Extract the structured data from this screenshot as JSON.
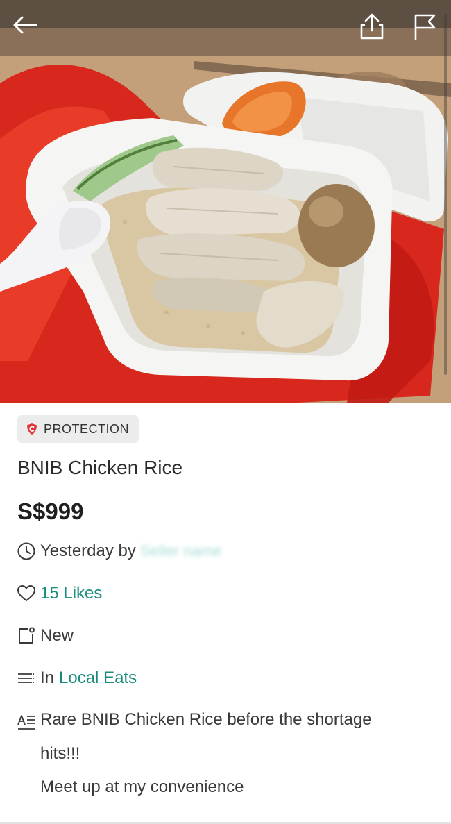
{
  "listing": {
    "badge": "PROTECTION",
    "title": "BNIB Chicken Rice",
    "price": "S$999",
    "time_prefix": "Yesterday by",
    "seller": "Seller name",
    "likes": "15 Likes",
    "condition": "New",
    "category_prefix": "In",
    "category": "Local Eats",
    "description": [
      "Rare BNIB Chicken Rice before the shortage",
      "hits!!!",
      "Meet up at my convenience"
    ]
  },
  "icons": {
    "back": "arrow-left-icon",
    "share": "share-icon",
    "report": "flag-icon",
    "badge": "shield-icon",
    "time": "clock-icon",
    "likes": "heart-icon",
    "condition": "tag-icon",
    "category": "list-icon",
    "description": "text-format-icon"
  },
  "colors": {
    "accent": "#1a8c7c",
    "badge_shield": "#e0343a",
    "badge_bg": "#ececec"
  }
}
